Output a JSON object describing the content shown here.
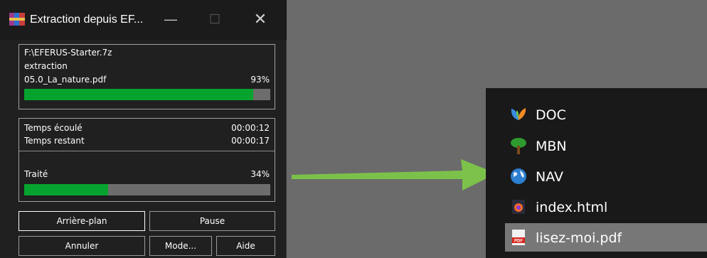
{
  "dialog": {
    "title": "Extraction depuis EF...",
    "archive_path": "F:\\EFERUS-Starter.7z",
    "operation": "extraction",
    "current_file": "05.0_La_nature.pdf",
    "file_percent": "93%",
    "file_progress": 0.93,
    "elapsed_label": "Temps écoulé",
    "elapsed_value": "00:00:12",
    "remaining_label": "Temps restant",
    "remaining_value": "00:00:17",
    "processed_label": "Traité",
    "processed_percent": "34%",
    "processed_progress": 0.34,
    "buttons": {
      "background": "Arrière-plan",
      "pause": "Pause",
      "cancel": "Annuler",
      "mode": "Mode...",
      "help": "Aide"
    }
  },
  "explorer": {
    "items": [
      {
        "label": "DOC",
        "icon": "msn-butterfly-icon"
      },
      {
        "label": "MBN",
        "icon": "tree-icon"
      },
      {
        "label": "NAV",
        "icon": "globe-icon"
      },
      {
        "label": "index.html",
        "icon": "firefox-html-icon"
      },
      {
        "label": "lisez-moi.pdf",
        "icon": "pdf-icon",
        "selected": true
      }
    ]
  },
  "colors": {
    "progress_fill": "#06a42e",
    "arrow": "#7cc24a",
    "selection": "#777777"
  }
}
